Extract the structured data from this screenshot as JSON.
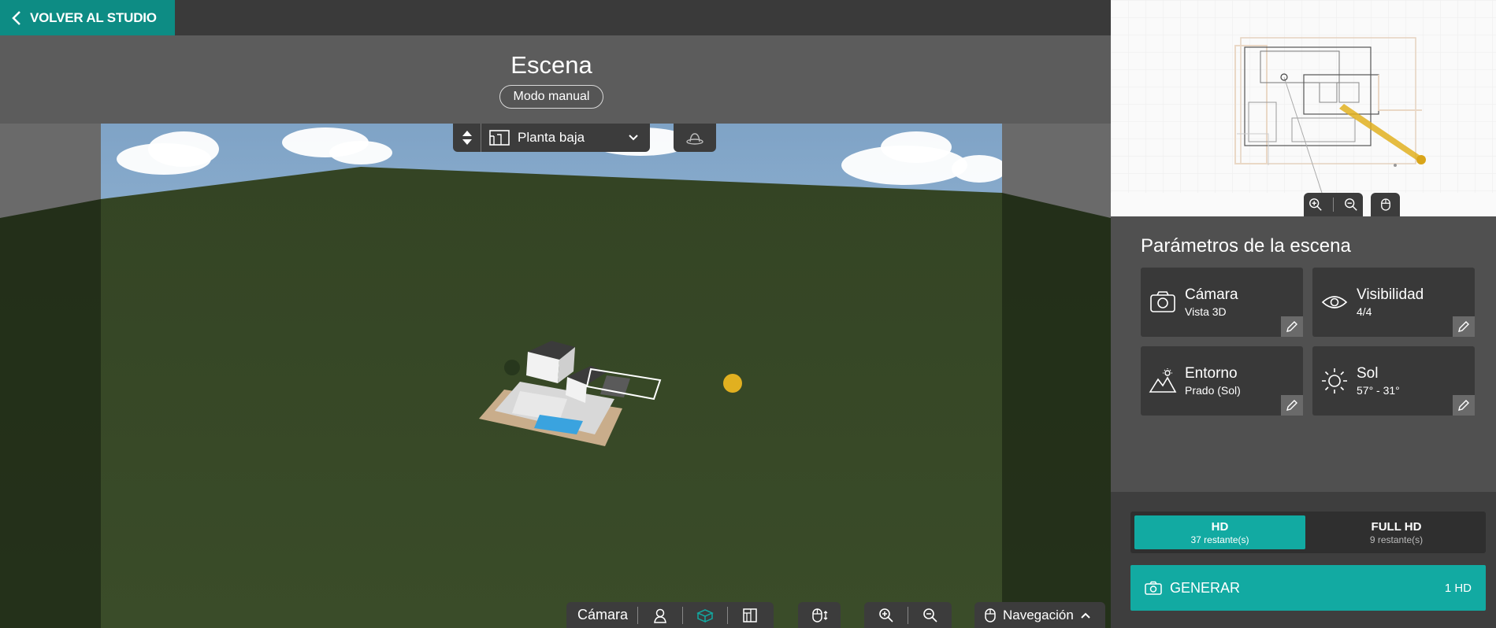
{
  "topbar": {
    "back_label": "VOLVER AL STUDIO"
  },
  "scene": {
    "title": "Escena",
    "mode": "Modo manual"
  },
  "floor_selector": {
    "current_floor": "Planta baja"
  },
  "bottom_toolbar": {
    "camera_label": "Cámara",
    "navigation_label": "Navegación"
  },
  "params": {
    "title": "Parámetros de la escena",
    "cards": [
      {
        "title": "Cámara",
        "value": "Vista 3D",
        "icon": "camera-icon"
      },
      {
        "title": "Visibilidad",
        "value": "4/4",
        "icon": "eye-icon"
      },
      {
        "title": "Entorno",
        "value": "Prado (Sol)",
        "icon": "landscape-icon"
      },
      {
        "title": "Sol",
        "value": "57° - 31°",
        "icon": "sun-icon"
      }
    ]
  },
  "render": {
    "options": [
      {
        "name": "HD",
        "remaining": "37 restante(s)",
        "selected": true
      },
      {
        "name": "FULL HD",
        "remaining": "9 restante(s)",
        "selected": false
      }
    ],
    "generate_label": "GENERAR",
    "generate_cost": "1 HD"
  },
  "colors": {
    "accent": "#12aaa2",
    "back_button": "#0d8c84",
    "sun_marker": "#e1b020",
    "grass": "#3a4a28"
  }
}
